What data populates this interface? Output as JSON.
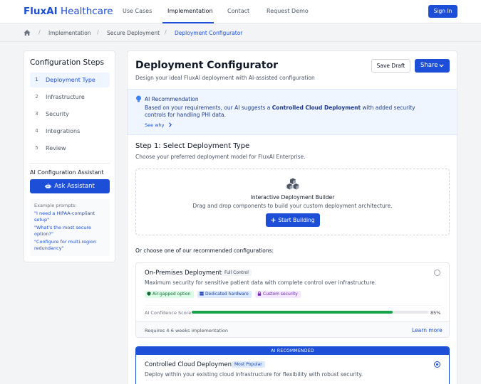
{
  "nav": {
    "brand_bold": "FluxAI",
    "brand_rest": "Healthcare",
    "links": [
      "Use Cases",
      "Implementation",
      "Contact",
      "Request Demo"
    ],
    "signin": "Sign In"
  },
  "breadcrumb": [
    "Implementation",
    "Secure Deployment",
    "Deployment Configurator"
  ],
  "sidebar": {
    "title": "Configuration Steps",
    "steps": [
      {
        "num": "1",
        "label": "Deployment Type"
      },
      {
        "num": "2",
        "label": "Infrastructure"
      },
      {
        "num": "3",
        "label": "Security"
      },
      {
        "num": "4",
        "label": "Integrations"
      },
      {
        "num": "5",
        "label": "Review"
      }
    ],
    "assistant_title": "AI Configuration Assistant",
    "ask_label": "Ask Assistant",
    "prompts_head": "Example prompts:",
    "prompts": [
      "\"I need a HIPAA-compliant setup\"",
      "\"What's the most secure option?\"",
      "\"Configure for multi-region redundancy\""
    ]
  },
  "main": {
    "title": "Deployment Configurator",
    "subtitle": "Design your ideal FluxAI deployment with AI-assisted configuration",
    "save_draft": "Save Draft",
    "share": "Share",
    "ai": {
      "title": "AI Recommendation",
      "text_before": "Based on your requirements, our AI suggests a ",
      "text_bold": "Controlled Cloud Deployment",
      "text_after": " with added security controls for handling PHI data.",
      "see_why": "See why"
    },
    "step_title": "Step 1: Select Deployment Type",
    "step_sub": "Choose your preferred deployment model for FluxAI Enterprise.",
    "builder": {
      "title": "Interactive Deployment Builder",
      "sub": "Drag and drop components to build your custom deployment architecture.",
      "button": "Start Building"
    },
    "choose_label": "Or choose one of our recommended configurations:",
    "cards": [
      {
        "title": "On-Premises Deployment",
        "badge": "Full Control",
        "desc": "Maximum security for sensitive patient data with complete control over infrastructure.",
        "tags": [
          "Air-gapped option",
          "Dedicated hardware",
          "Custom security"
        ],
        "confidence_label": "AI Confidence Score:",
        "confidence": 85,
        "confidence_text": "85%",
        "foot": "Requires 4-6 weeks implementation",
        "learn": "Learn more",
        "selected": false
      },
      {
        "banner": "AI RECOMMENDED",
        "title": "Controlled Cloud Deployment",
        "badge": "Most Popular",
        "desc": "Deploy within your existing cloud infrastructure for flexibility with robust security.",
        "selected": true
      }
    ]
  },
  "colors": {
    "accent": "#1d4ed8",
    "success": "#16a34a"
  }
}
